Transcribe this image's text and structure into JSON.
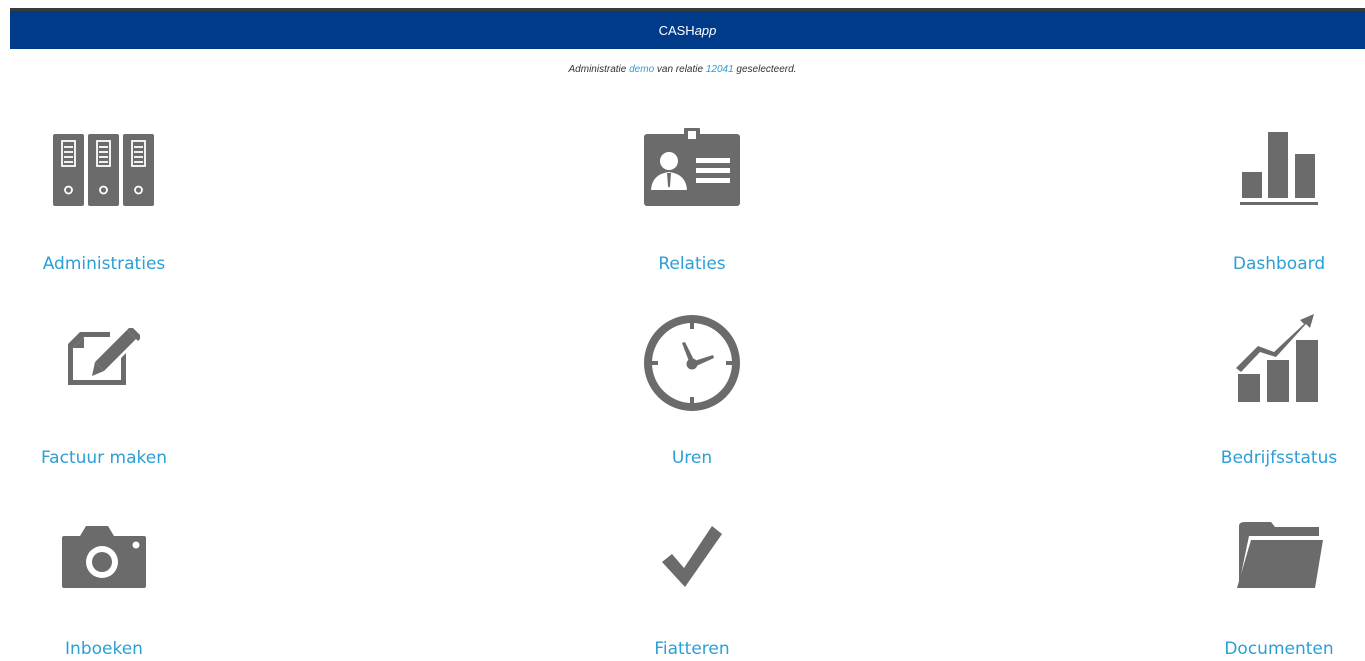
{
  "header": {
    "brand_main": "CASH",
    "brand_suffix": "app"
  },
  "status": {
    "prefix": "Administratie",
    "admin_name": "demo",
    "middle": "van relatie",
    "relation_id": "12041",
    "suffix": "geselecteerd."
  },
  "tiles": [
    {
      "label": "Administraties",
      "icon": "binders-icon"
    },
    {
      "label": "Relaties",
      "icon": "id-badge-icon"
    },
    {
      "label": "Dashboard",
      "icon": "bar-chart-icon"
    },
    {
      "label": "Factuur maken",
      "icon": "edit-document-icon"
    },
    {
      "label": "Uren",
      "icon": "clock-icon"
    },
    {
      "label": "Bedrijfsstatus",
      "icon": "growth-chart-icon"
    },
    {
      "label": "Inboeken",
      "icon": "camera-icon"
    },
    {
      "label": "Fiatteren",
      "icon": "checkmark-icon"
    },
    {
      "label": "Documenten",
      "icon": "folder-icon"
    }
  ],
  "colors": {
    "header_bg": "#003b8a",
    "link": "#2b9fd6",
    "icon": "#6b6b6b"
  }
}
